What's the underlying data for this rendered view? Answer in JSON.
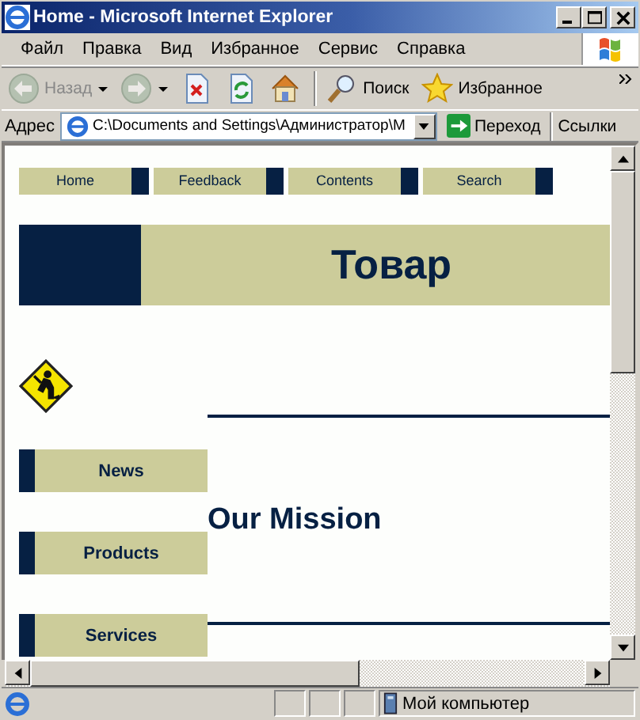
{
  "window": {
    "title": "Home - Microsoft Internet Explorer"
  },
  "menu": [
    "Файл",
    "Правка",
    "Вид",
    "Избранное",
    "Сервис",
    "Справка"
  ],
  "toolbar": [
    {
      "kind": "back",
      "label": "Назад",
      "disabled": true
    },
    {
      "kind": "forward",
      "disabled": true
    },
    {
      "kind": "stop"
    },
    {
      "kind": "refresh"
    },
    {
      "kind": "home"
    },
    {
      "kind": "search",
      "label": "Поиск"
    },
    {
      "kind": "favorites",
      "label": "Избранное"
    }
  ],
  "address_bar": {
    "label": "Адрес",
    "value": "C:\\Documents and Settings\\Администратор\\М",
    "go": "Переход",
    "links": "Ссылки"
  },
  "page": {
    "nav": [
      "Home",
      "Feedback",
      "Contents",
      "Search"
    ],
    "banner": "Товар",
    "side_nav": [
      "News",
      "Products",
      "Services"
    ],
    "heading": "Our Mission"
  },
  "status_bar": {
    "zone": "Мой компьютер"
  }
}
